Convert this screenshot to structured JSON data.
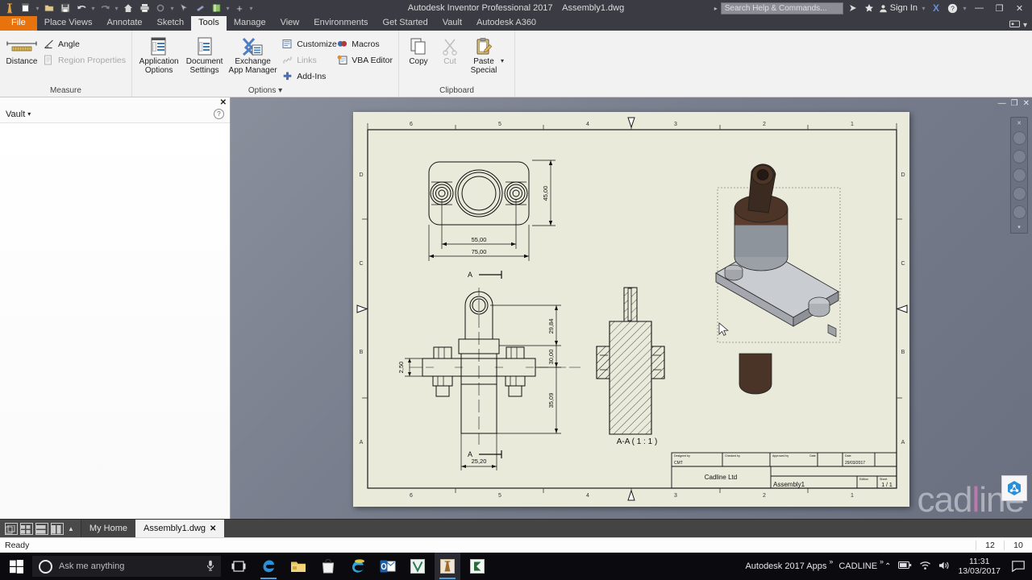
{
  "titlebar": {
    "app_title": "Autodesk Inventor Professional 2017",
    "document_title": "Assembly1.dwg",
    "search_placeholder": "Search Help & Commands...",
    "sign_in": "Sign In",
    "qat": [
      "inventor-logo-icon",
      "new-icon",
      "new-dropdown",
      "open-icon",
      "save-icon",
      "undo-icon",
      "undo-dropdown",
      "redo-icon",
      "redo-dropdown",
      "home-icon",
      "print-icon",
      "update-icon",
      "update-dropdown",
      "select-icon",
      "measure-icon",
      "material-icon",
      "material-dropdown",
      "customize-add-icon",
      "qat-dropdown"
    ],
    "window_buttons": [
      "minimize",
      "restore",
      "close"
    ]
  },
  "tabs": [
    {
      "label": "File",
      "kind": "file"
    },
    {
      "label": "Place Views",
      "kind": "normal"
    },
    {
      "label": "Annotate",
      "kind": "normal"
    },
    {
      "label": "Sketch",
      "kind": "normal"
    },
    {
      "label": "Tools",
      "kind": "active"
    },
    {
      "label": "Manage",
      "kind": "normal"
    },
    {
      "label": "View",
      "kind": "normal"
    },
    {
      "label": "Environments",
      "kind": "normal"
    },
    {
      "label": "Get Started",
      "kind": "normal"
    },
    {
      "label": "Vault",
      "kind": "normal"
    },
    {
      "label": "Autodesk A360",
      "kind": "normal"
    }
  ],
  "ribbon": {
    "panels": [
      {
        "title": "Measure",
        "big": [
          {
            "label1": "Distance",
            "label2": "",
            "icon": "ruler-icon"
          }
        ],
        "small": [
          {
            "label": "Angle",
            "icon": "angle-icon",
            "disabled": false
          },
          {
            "label": "Region Properties",
            "icon": "region-properties-icon",
            "disabled": true
          }
        ]
      },
      {
        "title": "Options",
        "big": [
          {
            "label1": "Application",
            "label2": "Options",
            "icon": "application-options-icon"
          },
          {
            "label1": "Document",
            "label2": "Settings",
            "icon": "document-settings-icon"
          },
          {
            "label1": "Exchange",
            "label2": "App Manager",
            "icon": "exchange-app-manager-icon"
          }
        ],
        "small": [
          {
            "label": "Customize",
            "icon": "customize-icon",
            "disabled": false
          },
          {
            "label": "Links",
            "icon": "links-icon",
            "disabled": true
          },
          {
            "label": "Add-Ins",
            "icon": "add-ins-icon",
            "disabled": false
          },
          {
            "label": "Macros",
            "icon": "macros-icon",
            "disabled": false
          },
          {
            "label": "VBA Editor",
            "icon": "vba-editor-icon",
            "disabled": false
          }
        ]
      },
      {
        "title": "Clipboard",
        "big": [
          {
            "label1": "Copy",
            "label2": "",
            "icon": "copy-icon"
          },
          {
            "label1": "Cut",
            "label2": "",
            "icon": "cut-icon"
          },
          {
            "label1": "Paste",
            "label2": "Special",
            "icon": "paste-special-icon"
          }
        ],
        "small": []
      }
    ]
  },
  "vault": {
    "title": "Vault",
    "dropdown": "▾",
    "help": "?",
    "close": "✕"
  },
  "drawing": {
    "zones_top": [
      "6",
      "5",
      "4",
      "3",
      "2",
      "1"
    ],
    "zones_left": [
      "D",
      "C",
      "B",
      "A"
    ],
    "section_label": "A-A ( 1 : 1 )",
    "section_marks": [
      "A",
      "A"
    ],
    "dims_top_view": [
      "45,00",
      "55,00",
      "75,00"
    ],
    "dims_front_view": [
      "29,84",
      "30,00",
      "35,09",
      "2,50",
      "25,20"
    ],
    "titleblock": {
      "designed_by_label": "Designed by",
      "designed_by_value": "CMT",
      "checked_by_label": "Checked by",
      "approved_by_label": "Approved by",
      "date_label": "Date",
      "date_label2": "Date",
      "date_value": "29/03/2017",
      "company": "Cadline Ltd",
      "doc_title": "Assembly1",
      "edition_label": "Edition",
      "sheet_label": "Sheet",
      "sheet_value": "1 / 1",
      "corner_zone": "A"
    },
    "watermark": "cadline"
  },
  "doctabs": {
    "view_tools": [
      "tile-cascade-icon",
      "tile-grid-icon",
      "tile-horizontal-icon",
      "tile-vertical-icon",
      "expand-icon"
    ],
    "tabs": [
      {
        "label": "My Home",
        "active": false,
        "closable": false
      },
      {
        "label": "Assembly1.dwg",
        "active": true,
        "closable": true,
        "close": "✕"
      }
    ]
  },
  "status": {
    "message": "Ready",
    "cell1": "12",
    "cell2": "10"
  },
  "taskbar": {
    "start": "windows-logo-icon",
    "search_placeholder": "Ask me anything",
    "mic": "microphone-icon",
    "taskview": "task-view-icon",
    "apps": [
      "edge-icon",
      "file-explorer-icon",
      "store-icon",
      "internet-explorer-icon",
      "outlook-icon",
      "vault-v-icon",
      "inventor-icon",
      "cadline-c-icon"
    ],
    "tray_left": [
      "Autodesk 2017 Apps",
      "CADLINE"
    ],
    "tray_icons": [
      "chevron-up-icon",
      "battery-icon",
      "wifi-icon",
      "volume-icon"
    ],
    "time": "11:31",
    "date": "13/03/2017",
    "action_center": "action-center-icon"
  },
  "colors": {
    "accent_orange": "#e8730c",
    "titlebar": "#3b3b44",
    "ribbon_bg": "#f2f2f2",
    "sheet_bg": "#e9eada",
    "canvas": "#6f7684",
    "taskbar": "#0a0a0f"
  }
}
